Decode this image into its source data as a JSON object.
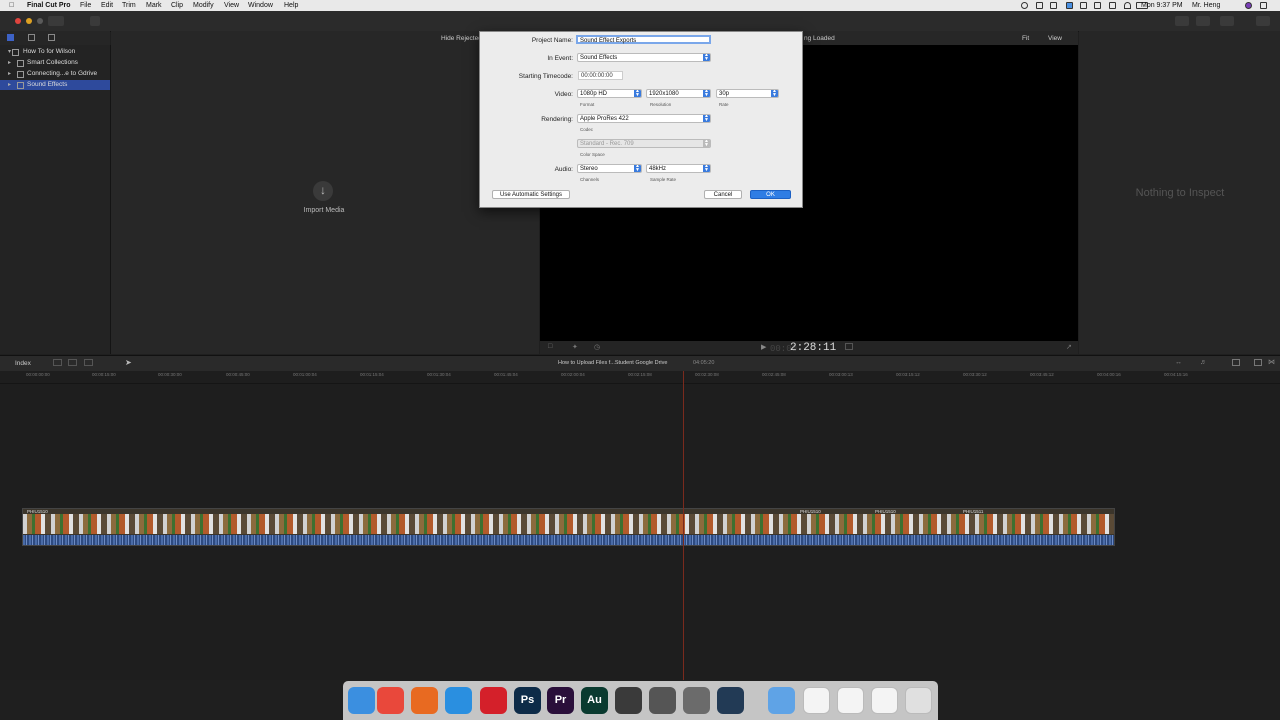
{
  "menubar": {
    "app": "Final Cut Pro",
    "menus": [
      "File",
      "Edit",
      "Trim",
      "Mark",
      "Clip",
      "Modify",
      "View",
      "Window",
      "Help"
    ],
    "clock": "Mon 9:37 PM",
    "user": "Mr. Heng"
  },
  "library": {
    "items": [
      {
        "label": "How To for Wilson"
      },
      {
        "label": "Smart Collections"
      },
      {
        "label": "Connecting...e to Gdrive"
      },
      {
        "label": "Sound Effects"
      }
    ]
  },
  "browser": {
    "filter_label": "Hide Rejected",
    "import_label": "Import Media"
  },
  "viewer": {
    "status": "ng Loaded",
    "fit_label": "Fit",
    "view_label": "View",
    "timecode": "2:28:11",
    "timecode_prefix": "00:00"
  },
  "inspector": {
    "empty_text": "Nothing to Inspect"
  },
  "timeline": {
    "index_label": "Index",
    "project_title": "How to Upload Files f...Student Google Drive",
    "project_duration": "04:05:20",
    "ruler_labels": [
      "00:00:00:00",
      "00:00:15:00",
      "00:00:30:00",
      "00:00:45:00",
      "00:01:00:04",
      "00:01:15:04",
      "00:01:30:04",
      "00:01:45:04",
      "00:02:00:04",
      "00:02:15:08",
      "00:02:30:08",
      "00:02:45:08",
      "00:03:00:13",
      "00:03:15:12",
      "00:03:30:12",
      "00:03:45:12",
      "00:04:00:16",
      "00:04:15:16"
    ],
    "clip_names": [
      "PHIU1510",
      "PHIU1510",
      "PHIU1510",
      "PHIU1511"
    ]
  },
  "dialog": {
    "project_name_label": "Project Name:",
    "project_name_value": "Sound Effect Exports",
    "event_label": "In Event:",
    "event_value": "Sound Effects",
    "timecode_label": "Starting Timecode:",
    "timecode_value": "00:00:00:00",
    "video_label": "Video:",
    "format_value": "1080p HD",
    "format_caption": "Format",
    "resolution_value": "1920x1080",
    "resolution_caption": "Resolution",
    "rate_value": "30p",
    "rate_caption": "Rate",
    "rendering_label": "Rendering:",
    "codec_value": "Apple ProRes 422",
    "codec_caption": "Codec",
    "colorspace_value": "Standard - Rec. 709",
    "colorspace_caption": "Color Space",
    "audio_label": "Audio:",
    "channels_value": "Stereo",
    "channels_caption": "Channels",
    "samplerate_value": "48kHz",
    "samplerate_caption": "Sample Rate",
    "auto_button": "Use Automatic Settings",
    "cancel_button": "Cancel",
    "ok_button": "OK"
  },
  "dock": {
    "apps": [
      {
        "icon": "finder-icon",
        "color": "#3b8fe0",
        "label": ""
      },
      {
        "icon": "chrome-icon",
        "color": "#e9483b",
        "label": ""
      },
      {
        "icon": "firefox-icon",
        "color": "#e86a21",
        "label": ""
      },
      {
        "icon": "safari-icon",
        "color": "#2a8fe0",
        "label": ""
      },
      {
        "icon": "opera-icon",
        "color": "#d4202a",
        "label": ""
      },
      {
        "icon": "photoshop-icon",
        "color": "#0d2b48",
        "label": "Ps"
      },
      {
        "icon": "premiere-icon",
        "color": "#2a0f3a",
        "label": "Pr"
      },
      {
        "icon": "audition-icon",
        "color": "#0a3a2f",
        "label": "Au"
      },
      {
        "icon": "final-cut-icon",
        "color": "#3a3a3a",
        "label": ""
      },
      {
        "icon": "motion-icon",
        "color": "#555555",
        "label": ""
      },
      {
        "icon": "system-preferences-icon",
        "color": "#6b6b6b",
        "label": ""
      },
      {
        "icon": "quicktime-icon",
        "color": "#223a55",
        "label": ""
      },
      {
        "icon": "folder-icon",
        "color": "#5fa3e6",
        "label": ""
      },
      {
        "icon": "document-icon",
        "color": "#f4f4f4",
        "label": ""
      },
      {
        "icon": "document-icon",
        "color": "#f4f4f4",
        "label": ""
      },
      {
        "icon": "document-icon",
        "color": "#f4f4f4",
        "label": ""
      },
      {
        "icon": "trash-icon",
        "color": "#e0e0e0",
        "label": ""
      }
    ]
  }
}
